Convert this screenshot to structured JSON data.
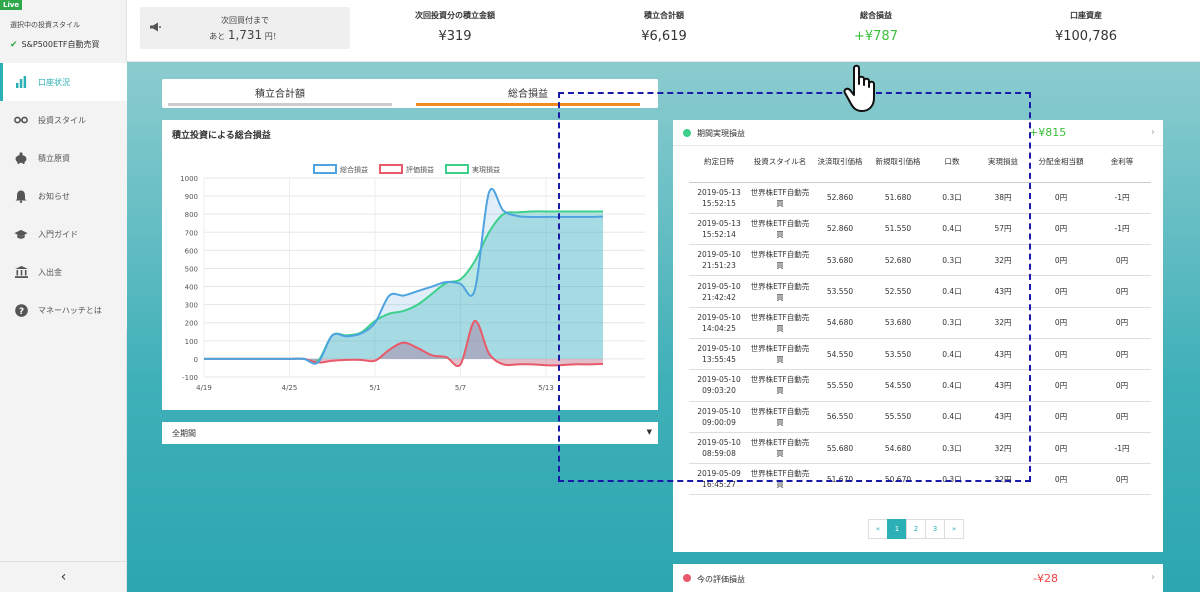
{
  "sidebar": {
    "live_badge": "Live",
    "style_label": "選択中の投資スタイル",
    "style_value": "S&P500ETF自動売買",
    "items": [
      {
        "label": "口座状況",
        "icon": "bar-chart-icon"
      },
      {
        "label": "投資スタイル",
        "icon": "glasses-icon"
      },
      {
        "label": "積立原資",
        "icon": "piggy-bank-icon"
      },
      {
        "label": "お知らせ",
        "icon": "bell-icon"
      },
      {
        "label": "入門ガイド",
        "icon": "graduation-cap-icon"
      },
      {
        "label": "入出金",
        "icon": "bank-icon"
      },
      {
        "label": "マネーハッチとは",
        "icon": "question-circle-icon"
      }
    ],
    "collapse_label": "‹"
  },
  "header": {
    "notice_line1": "次回買付まで",
    "notice_prefix": "あと",
    "notice_amount": "1,731",
    "notice_suffix": "円！",
    "stats": [
      {
        "label": "次回投資分の積立金額",
        "value": "¥319"
      },
      {
        "label": "積立合計額",
        "value": "¥6,619"
      },
      {
        "label": "総合損益",
        "value": "+¥787"
      },
      {
        "label": "口座資産",
        "value": "¥100,786"
      }
    ]
  },
  "tabs": [
    "積立合計額",
    "総合損益"
  ],
  "chart": {
    "title": "積立投資による総合損益"
  },
  "chart_data": {
    "type": "area",
    "legend": [
      "総合損益",
      "評価損益",
      "実現損益"
    ],
    "legend_position": "top-center",
    "x_ticks": [
      "4/19",
      "4/25",
      "5/1",
      "5/7",
      "5/13"
    ],
    "y_ticks": [
      "1000",
      "900",
      "800",
      "700",
      "600",
      "500",
      "400",
      "300",
      "200",
      "100",
      "0",
      "-100"
    ],
    "ylim": [
      -100,
      1000
    ],
    "colors": {
      "総合損益": "#4ea3e0",
      "評価損益": "#e85a6a",
      "実現損益": "#3cd08c"
    },
    "x": [
      "4/19",
      "4/20",
      "4/21",
      "4/22",
      "4/23",
      "4/24",
      "4/25",
      "4/26",
      "4/27",
      "4/28",
      "4/29",
      "4/30",
      "5/1",
      "5/2",
      "5/3",
      "5/4",
      "5/5",
      "5/6",
      "5/7",
      "5/8",
      "5/9",
      "5/10",
      "5/11",
      "5/12",
      "5/13",
      "5/14",
      "5/15",
      "5/16",
      "5/17"
    ],
    "series": [
      {
        "name": "総合損益",
        "values": [
          0,
          0,
          0,
          0,
          0,
          0,
          0,
          0,
          -20,
          130,
          125,
          140,
          200,
          350,
          350,
          375,
          400,
          425,
          415,
          380,
          920,
          820,
          790,
          785,
          785,
          785,
          785,
          785,
          787
        ]
      },
      {
        "name": "評価損益",
        "values": [
          0,
          0,
          0,
          0,
          0,
          0,
          0,
          0,
          -20,
          -10,
          -5,
          -5,
          -10,
          50,
          90,
          60,
          20,
          10,
          -30,
          210,
          30,
          -30,
          -30,
          -30,
          -35,
          -35,
          -30,
          -30,
          -28
        ]
      },
      {
        "name": "実現損益",
        "values": [
          0,
          0,
          0,
          0,
          0,
          0,
          0,
          0,
          -10,
          130,
          130,
          145,
          210,
          250,
          265,
          300,
          360,
          420,
          440,
          540,
          700,
          800,
          810,
          815,
          815,
          815,
          815,
          815,
          815
        ]
      }
    ]
  },
  "period_select": "全期間",
  "realized": {
    "label": "期間実現損益",
    "value": "+¥815"
  },
  "table": {
    "headers": [
      "約定日時",
      "投資スタイル名",
      "決済取引価格",
      "新規取引価格",
      "口数",
      "実現損益",
      "分配金相当額",
      "金利等"
    ],
    "rows": [
      [
        "2019-05-13 15:52:15",
        "世界株ETF自動売買",
        "52.860",
        "51.680",
        "0.3口",
        "38円",
        "0円",
        "-1円"
      ],
      [
        "2019-05-13 15:52:14",
        "世界株ETF自動売買",
        "52.860",
        "51.550",
        "0.4口",
        "57円",
        "0円",
        "-1円"
      ],
      [
        "2019-05-10 21:51:23",
        "世界株ETF自動売買",
        "53.680",
        "52.680",
        "0.3口",
        "32円",
        "0円",
        "0円"
      ],
      [
        "2019-05-10 21:42:42",
        "世界株ETF自動売買",
        "53.550",
        "52.550",
        "0.4口",
        "43円",
        "0円",
        "0円"
      ],
      [
        "2019-05-10 14:04:25",
        "世界株ETF自動売買",
        "54.680",
        "53.680",
        "0.3口",
        "32円",
        "0円",
        "0円"
      ],
      [
        "2019-05-10 13:55:45",
        "世界株ETF自動売買",
        "54.550",
        "53.550",
        "0.4口",
        "43円",
        "0円",
        "0円"
      ],
      [
        "2019-05-10 09:03:20",
        "世界株ETF自動売買",
        "55.550",
        "54.550",
        "0.4口",
        "43円",
        "0円",
        "0円"
      ],
      [
        "2019-05-10 09:00:09",
        "世界株ETF自動売買",
        "56.550",
        "55.550",
        "0.4口",
        "43円",
        "0円",
        "0円"
      ],
      [
        "2019-05-10 08:59:08",
        "世界株ETF自動売買",
        "55.680",
        "54.680",
        "0.3口",
        "32円",
        "0円",
        "-1円"
      ],
      [
        "2019-05-09 16:45:27",
        "世界株ETF自動売買",
        "51.670",
        "50.670",
        "0.3口",
        "32円",
        "0円",
        "0円"
      ]
    ]
  },
  "pagination": [
    "«",
    "1",
    "2",
    "3",
    "»"
  ],
  "pagination_active": "1",
  "unrealized": {
    "label": "今の評価損益",
    "value": "-¥28"
  }
}
